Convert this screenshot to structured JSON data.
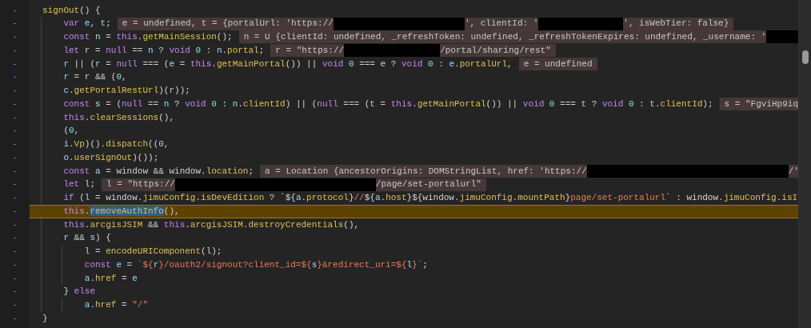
{
  "lines": [
    {
      "marker": "-",
      "highlighted": false,
      "tokens": [
        {
          "kind": "fn",
          "text": "signOut"
        },
        {
          "kind": "p",
          "text": "() {"
        }
      ],
      "children": [
        {
          "marker": "-",
          "highlighted": false,
          "tokens": [
            {
              "kind": "kw",
              "text": "var "
            },
            {
              "kind": "var",
              "text": "e"
            },
            {
              "kind": "p",
              "text": ", "
            },
            {
              "kind": "var",
              "text": "t"
            },
            {
              "kind": "p",
              "text": ";"
            }
          ],
          "hint": [
            {
              "kind": "text",
              "text": "e = undefined, t = {portalUrl: 'https://"
            },
            {
              "kind": "redacted"
            },
            {
              "kind": "text",
              "text": "', clientId: '"
            },
            {
              "kind": "redacted"
            },
            {
              "kind": "text",
              "text": "', isWebTier: false}"
            }
          ]
        },
        {
          "marker": "-",
          "highlighted": false,
          "tokens": [
            {
              "kind": "kw",
              "text": "const "
            },
            {
              "kind": "var",
              "text": "n"
            },
            {
              "kind": "p",
              "text": " = "
            },
            {
              "kind": "kw",
              "text": "this"
            },
            {
              "kind": "p",
              "text": "."
            },
            {
              "kind": "fn",
              "text": "getMainSession"
            },
            {
              "kind": "p",
              "text": "();"
            }
          ],
          "hint": [
            {
              "kind": "text",
              "text": "n = U {clientId: undefined, _refreshToken: undefined, _refreshTokenExpires: undefined, _username: '"
            },
            {
              "kind": "redacted"
            }
          ]
        },
        {
          "marker": "-",
          "highlighted": false,
          "tokens": [
            {
              "kind": "kw",
              "text": "let "
            },
            {
              "kind": "var",
              "text": "r"
            },
            {
              "kind": "p",
              "text": " = "
            },
            {
              "kind": "kw",
              "text": "null"
            },
            {
              "kind": "p",
              "text": " == "
            },
            {
              "kind": "var",
              "text": "n"
            },
            {
              "kind": "p",
              "text": " ? "
            },
            {
              "kind": "kw",
              "text": "void "
            },
            {
              "kind": "num",
              "text": "0"
            },
            {
              "kind": "p",
              "text": " : "
            },
            {
              "kind": "var",
              "text": "n"
            },
            {
              "kind": "p",
              "text": "."
            },
            {
              "kind": "fn",
              "text": "portal"
            },
            {
              "kind": "p",
              "text": ";"
            }
          ],
          "hint": [
            {
              "kind": "text",
              "text": "r = \"https://"
            },
            {
              "kind": "redacted"
            },
            {
              "kind": "text",
              "text": "/portal/sharing/rest\""
            }
          ]
        },
        {
          "marker": "-",
          "highlighted": false,
          "tokens": [
            {
              "kind": "var",
              "text": "r"
            },
            {
              "kind": "p",
              "text": " || ("
            },
            {
              "kind": "var",
              "text": "r"
            },
            {
              "kind": "p",
              "text": " = "
            },
            {
              "kind": "kw",
              "text": "null"
            },
            {
              "kind": "p",
              "text": " === ("
            },
            {
              "kind": "var",
              "text": "e"
            },
            {
              "kind": "p",
              "text": " = "
            },
            {
              "kind": "kw",
              "text": "this"
            },
            {
              "kind": "p",
              "text": "."
            },
            {
              "kind": "fn",
              "text": "getMainPortal"
            },
            {
              "kind": "p",
              "text": "()) || "
            },
            {
              "kind": "kw",
              "text": "void "
            },
            {
              "kind": "num",
              "text": "0"
            },
            {
              "kind": "p",
              "text": " === "
            },
            {
              "kind": "var",
              "text": "e"
            },
            {
              "kind": "p",
              "text": " ? "
            },
            {
              "kind": "kw",
              "text": "void "
            },
            {
              "kind": "num",
              "text": "0"
            },
            {
              "kind": "p",
              "text": " : "
            },
            {
              "kind": "var",
              "text": "e"
            },
            {
              "kind": "p",
              "text": "."
            },
            {
              "kind": "fn",
              "text": "portalUrl"
            },
            {
              "kind": "p",
              "text": ","
            }
          ],
          "hint": [
            {
              "kind": "text",
              "text": "e = undefined"
            }
          ]
        },
        {
          "marker": "-",
          "highlighted": false,
          "tokens": [
            {
              "kind": "var",
              "text": "r"
            },
            {
              "kind": "p",
              "text": " = "
            },
            {
              "kind": "var",
              "text": "r"
            },
            {
              "kind": "p",
              "text": " && ("
            },
            {
              "kind": "num",
              "text": "0"
            },
            {
              "kind": "p",
              "text": ","
            }
          ]
        },
        {
          "marker": "-",
          "highlighted": false,
          "tokens": [
            {
              "kind": "var",
              "text": "c"
            },
            {
              "kind": "p",
              "text": "."
            },
            {
              "kind": "fn",
              "text": "getPortalRestUrl"
            },
            {
              "kind": "p",
              "text": ")("
            },
            {
              "kind": "var",
              "text": "r"
            },
            {
              "kind": "p",
              "text": "));"
            }
          ]
        },
        {
          "marker": "-",
          "highlighted": false,
          "tokens": [
            {
              "kind": "kw",
              "text": "const "
            },
            {
              "kind": "var",
              "text": "s"
            },
            {
              "kind": "p",
              "text": " = ("
            },
            {
              "kind": "kw",
              "text": "null"
            },
            {
              "kind": "p",
              "text": " == "
            },
            {
              "kind": "var",
              "text": "n"
            },
            {
              "kind": "p",
              "text": " ? "
            },
            {
              "kind": "kw",
              "text": "void "
            },
            {
              "kind": "num",
              "text": "0"
            },
            {
              "kind": "p",
              "text": " : "
            },
            {
              "kind": "var",
              "text": "n"
            },
            {
              "kind": "p",
              "text": "."
            },
            {
              "kind": "fn",
              "text": "clientId"
            },
            {
              "kind": "p",
              "text": ") || ("
            },
            {
              "kind": "kw",
              "text": "null"
            },
            {
              "kind": "p",
              "text": " === ("
            },
            {
              "kind": "var",
              "text": "t"
            },
            {
              "kind": "p",
              "text": " = "
            },
            {
              "kind": "kw",
              "text": "this"
            },
            {
              "kind": "p",
              "text": "."
            },
            {
              "kind": "fn",
              "text": "getMainPortal"
            },
            {
              "kind": "p",
              "text": "()) || "
            },
            {
              "kind": "kw",
              "text": "void "
            },
            {
              "kind": "num",
              "text": "0"
            },
            {
              "kind": "p",
              "text": " === "
            },
            {
              "kind": "var",
              "text": "t"
            },
            {
              "kind": "p",
              "text": " ? "
            },
            {
              "kind": "kw",
              "text": "void "
            },
            {
              "kind": "num",
              "text": "0"
            },
            {
              "kind": "p",
              "text": " : "
            },
            {
              "kind": "var",
              "text": "t"
            },
            {
              "kind": "p",
              "text": "."
            },
            {
              "kind": "fn",
              "text": "clientId"
            },
            {
              "kind": "p",
              "text": ");"
            }
          ],
          "hint": [
            {
              "kind": "text",
              "text": "s = \"FgviHp9iq"
            }
          ]
        },
        {
          "marker": "-",
          "highlighted": false,
          "tokens": [
            {
              "kind": "kw",
              "text": "this"
            },
            {
              "kind": "p",
              "text": "."
            },
            {
              "kind": "fn",
              "text": "clearSessions"
            },
            {
              "kind": "p",
              "text": "(),"
            }
          ]
        },
        {
          "marker": "-",
          "highlighted": false,
          "tokens": [
            {
              "kind": "p",
              "text": "("
            },
            {
              "kind": "num",
              "text": "0"
            },
            {
              "kind": "p",
              "text": ","
            }
          ]
        },
        {
          "marker": "-",
          "highlighted": false,
          "tokens": [
            {
              "kind": "var",
              "text": "i"
            },
            {
              "kind": "p",
              "text": "."
            },
            {
              "kind": "fn",
              "text": "Vp"
            },
            {
              "kind": "p",
              "text": ")()."
            },
            {
              "kind": "fn",
              "text": "dispatch"
            },
            {
              "kind": "p",
              "text": "(("
            },
            {
              "kind": "num",
              "text": "0"
            },
            {
              "kind": "p",
              "text": ","
            }
          ]
        },
        {
          "marker": "-",
          "highlighted": false,
          "tokens": [
            {
              "kind": "var",
              "text": "o"
            },
            {
              "kind": "p",
              "text": "."
            },
            {
              "kind": "fn",
              "text": "userSignOut"
            },
            {
              "kind": "p",
              "text": ")());"
            }
          ]
        },
        {
          "marker": "-",
          "highlighted": false,
          "tokens": [
            {
              "kind": "kw",
              "text": "const "
            },
            {
              "kind": "var",
              "text": "a"
            },
            {
              "kind": "p",
              "text": " = window && window."
            },
            {
              "kind": "fn",
              "text": "location"
            },
            {
              "kind": "p",
              "text": ";"
            }
          ],
          "hint": [
            {
              "kind": "text",
              "text": "a = Location {ancestorOrigins: DOMStringList, href: 'https://"
            },
            {
              "kind": "redacted"
            },
            {
              "kind": "text",
              "text": "/'"
            }
          ]
        },
        {
          "marker": "-",
          "highlighted": false,
          "tokens": [
            {
              "kind": "kw",
              "text": "let "
            },
            {
              "kind": "var",
              "text": "l"
            },
            {
              "kind": "p",
              "text": ";"
            }
          ],
          "hint": [
            {
              "kind": "text",
              "text": "l = \"https://"
            },
            {
              "kind": "redacted"
            },
            {
              "kind": "text",
              "text": "/page/set-portalurl\""
            }
          ]
        },
        {
          "marker": "-",
          "highlighted": false,
          "tokens": [
            {
              "kind": "kw",
              "text": "if"
            },
            {
              "kind": "p",
              "text": " ("
            },
            {
              "kind": "var",
              "text": "l"
            },
            {
              "kind": "p",
              "text": " = window."
            },
            {
              "kind": "fn",
              "text": "jimuConfig"
            },
            {
              "kind": "p",
              "text": "."
            },
            {
              "kind": "fn",
              "text": "isDevEdition"
            },
            {
              "kind": "p",
              "text": " ? `${"
            },
            {
              "kind": "var",
              "text": "a"
            },
            {
              "kind": "p",
              "text": "."
            },
            {
              "kind": "fn",
              "text": "protocol"
            },
            {
              "kind": "p",
              "text": "}"
            },
            {
              "kind": "str",
              "text": "//"
            },
            {
              "kind": "p",
              "text": "${"
            },
            {
              "kind": "var",
              "text": "a"
            },
            {
              "kind": "p",
              "text": "."
            },
            {
              "kind": "fn",
              "text": "host"
            },
            {
              "kind": "p",
              "text": "}${window."
            },
            {
              "kind": "fn",
              "text": "jimuConfig"
            },
            {
              "kind": "p",
              "text": "."
            },
            {
              "kind": "fn",
              "text": "mountPath"
            },
            {
              "kind": "p",
              "text": "}"
            },
            {
              "kind": "str",
              "text": "page/set-portalurl"
            },
            {
              "kind": "p",
              "text": "` : window."
            },
            {
              "kind": "fn",
              "text": "jimuConfig"
            },
            {
              "kind": "p",
              "text": "."
            },
            {
              "kind": "fn",
              "text": "isI"
            }
          ]
        },
        {
          "marker": "-",
          "highlighted": true,
          "tokens": [
            {
              "kind": "kw",
              "text": "this"
            },
            {
              "kind": "p",
              "text": "."
            },
            {
              "kind": "selection",
              "text": "removeAuthInfo"
            },
            {
              "kind": "p",
              "text": "(),"
            }
          ]
        },
        {
          "marker": "-",
          "highlighted": false,
          "tokens": [
            {
              "kind": "kw",
              "text": "this"
            },
            {
              "kind": "p",
              "text": "."
            },
            {
              "kind": "fn",
              "text": "arcgisJSIM"
            },
            {
              "kind": "p",
              "text": " && "
            },
            {
              "kind": "kw",
              "text": "this"
            },
            {
              "kind": "p",
              "text": "."
            },
            {
              "kind": "fn",
              "text": "arcgisJSIM"
            },
            {
              "kind": "p",
              "text": "."
            },
            {
              "kind": "fn",
              "text": "destroyCredentials"
            },
            {
              "kind": "p",
              "text": "(),"
            }
          ]
        },
        {
          "marker": "-",
          "highlighted": false,
          "tokens": [
            {
              "kind": "var",
              "text": "r"
            },
            {
              "kind": "p",
              "text": " && "
            },
            {
              "kind": "var",
              "text": "s"
            },
            {
              "kind": "p",
              "text": ") {"
            }
          ],
          "children": [
            {
              "marker": "-",
              "highlighted": false,
              "tokens": [
                {
                  "kind": "var",
                  "text": "l"
                },
                {
                  "kind": "p",
                  "text": " = "
                },
                {
                  "kind": "fn",
                  "text": "encodeURIComponent"
                },
                {
                  "kind": "p",
                  "text": "("
                },
                {
                  "kind": "var",
                  "text": "l"
                },
                {
                  "kind": "p",
                  "text": ");"
                }
              ]
            },
            {
              "marker": "-",
              "highlighted": false,
              "tokens": [
                {
                  "kind": "kw",
                  "text": "const "
                },
                {
                  "kind": "var",
                  "text": "e"
                },
                {
                  "kind": "p",
                  "text": " = "
                },
                {
                  "kind": "str",
                  "text": "`${"
                },
                {
                  "kind": "var",
                  "text": "r"
                },
                {
                  "kind": "str",
                  "text": "}/oauth2/signout?client_id=${"
                },
                {
                  "kind": "var",
                  "text": "s"
                },
                {
                  "kind": "str",
                  "text": "}&redirect_uri=${"
                },
                {
                  "kind": "var",
                  "text": "l"
                },
                {
                  "kind": "str",
                  "text": "}`"
                },
                {
                  "kind": "p",
                  "text": ";"
                }
              ]
            },
            {
              "marker": "-",
              "highlighted": false,
              "tokens": [
                {
                  "kind": "var",
                  "text": "a"
                },
                {
                  "kind": "p",
                  "text": "."
                },
                {
                  "kind": "fn",
                  "text": "href"
                },
                {
                  "kind": "p",
                  "text": " = "
                },
                {
                  "kind": "var",
                  "text": "e"
                }
              ]
            }
          ]
        },
        {
          "marker": "-",
          "highlighted": false,
          "tokens": [
            {
              "kind": "p",
              "text": "} "
            },
            {
              "kind": "kw",
              "text": "else"
            }
          ],
          "children": [
            {
              "marker": "-",
              "highlighted": false,
              "tokens": [
                {
                  "kind": "var",
                  "text": "a"
                },
                {
                  "kind": "p",
                  "text": "."
                },
                {
                  "kind": "fn",
                  "text": "href"
                },
                {
                  "kind": "p",
                  "text": " = "
                },
                {
                  "kind": "str",
                  "text": "\"/\""
                }
              ]
            }
          ]
        }
      ]
    },
    {
      "marker": "-",
      "highlighted": false,
      "tokens": [
        {
          "kind": "p",
          "text": "}"
        }
      ]
    }
  ]
}
